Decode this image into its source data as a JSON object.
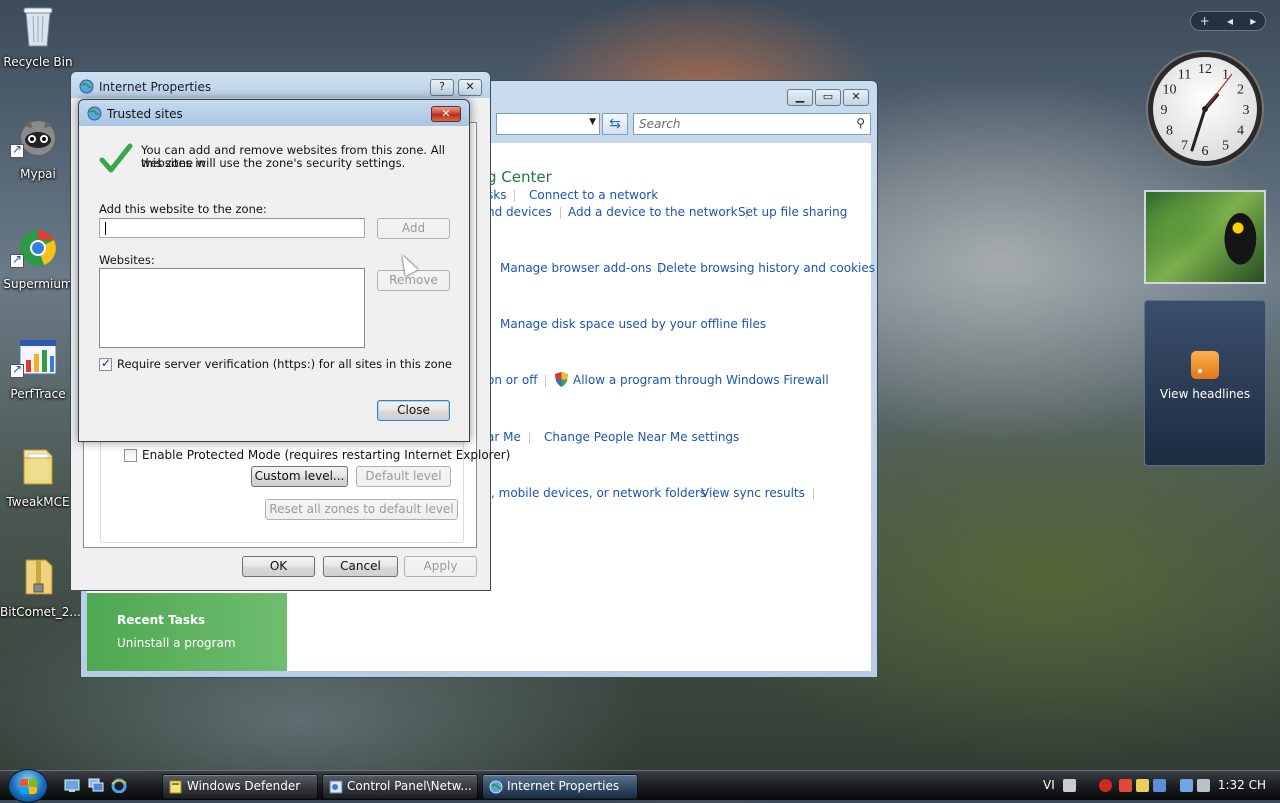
{
  "desktop": {
    "icons": [
      {
        "label": "Recycle Bin"
      },
      {
        "label": "Mypai"
      },
      {
        "label": "Supermium"
      },
      {
        "label": "PerfTrace"
      },
      {
        "label": "TweakMCE"
      },
      {
        "label": "BitComet_2..."
      }
    ]
  },
  "control_panel": {
    "search_placeholder": "Search",
    "title_fragment": "g Center",
    "links": {
      "tasks_fragment": "sks",
      "connect_network": "Connect to a network",
      "devices_fragment": "nd devices",
      "add_device": "Add a device to the network",
      "setup_file_sharing": "Set up file sharing",
      "manage_addons": "Manage browser add-ons",
      "delete_history": "Delete browsing history and cookies",
      "manage_disk_space": "Manage disk space used by your offline files",
      "on_off_fragment": "on or off",
      "allow_program_firewall": "Allow a program through Windows Firewall",
      "near_me_fragment": "ar Me",
      "change_people_near_me": "Change People Near Me settings",
      "mobile_devices_fragment": ", mobile devices, or network folders",
      "view_sync_results": "View sync results"
    },
    "recent_tasks": {
      "heading": "Recent Tasks",
      "uninstall": "Uninstall a program"
    }
  },
  "internet_properties": {
    "title": "Internet Properties",
    "help_label": "?",
    "close_label": "✕",
    "protected_mode_label": "Enable Protected Mode (requires restarting Internet Explorer)",
    "protected_mode_checked": false,
    "custom_level_label": "Custom level...",
    "default_level_label": "Default level",
    "reset_zones_label": "Reset all zones to default level",
    "ok_label": "OK",
    "cancel_label": "Cancel",
    "apply_label": "Apply"
  },
  "trusted_sites": {
    "title": "Trusted sites",
    "close_label": "✕",
    "message_line1": "You can add and remove websites from this zone. All websites in",
    "message_line2": "this zone will use the zone's security settings.",
    "add_label_text": "Add this website to the zone:",
    "website_input_value": "",
    "add_button_label": "Add",
    "websites_label": "Websites:",
    "websites": [],
    "remove_button_label": "Remove",
    "require_https_label": "Require server verification (https:) for all sites in this zone",
    "require_https_checked": true,
    "close_button_label": "Close"
  },
  "gadgets": {
    "bar_add_label": "+",
    "bar_prev_label": "◂",
    "bar_next_label": "▸",
    "feed_label": "View headlines",
    "clock_numbers": [
      "12",
      "1",
      "2",
      "3",
      "4",
      "5",
      "6",
      "7",
      "8",
      "9",
      "10",
      "11"
    ]
  },
  "taskbar": {
    "buttons": [
      {
        "label": "Windows Defender",
        "active": false
      },
      {
        "label": "Control Panel\\Netw...",
        "active": false
      },
      {
        "label": "Internet Properties",
        "active": true
      }
    ],
    "tray": {
      "language": "VI",
      "time": "1:32 CH"
    }
  },
  "colors": {
    "link_blue": "#1a55b4",
    "title_green": "#1e7a3a",
    "recent_tasks_green": "#4ea852",
    "close_red": "#c5412a"
  }
}
